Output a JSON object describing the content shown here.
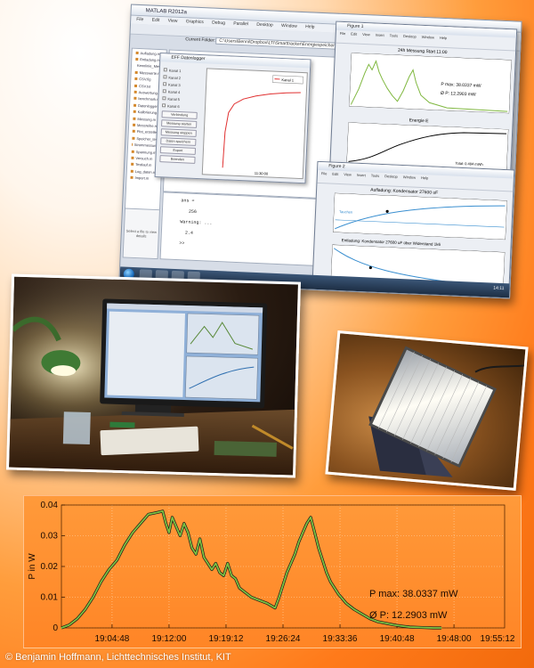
{
  "screenshot": {
    "matlab": {
      "title": "MATLAB R2012a",
      "menu": [
        "File",
        "Edit",
        "View",
        "Graphics",
        "Debug",
        "Parallel",
        "Desktop",
        "Window",
        "Help"
      ],
      "current_folder_label": "Current Folder:",
      "current_folder": "C:\\Users\\Benni\\Dropbox\\LTI\\Smarttracker\\Energiespeicher\\Messungen",
      "folder_items": [
        "Aufladung.m",
        "Entladung.m",
        "Kennlinie_Messung.m",
        "Messwerte.mat",
        "CSV.fig",
        "CSV.txt",
        "Auswertung.m",
        "benchmark.m",
        "Datenlogger.m",
        "Kalibrierung.m",
        "Messung.m",
        "Messreihe.mat",
        "Plot_erstellen.m",
        "Speicher_test.m",
        "Strommessung.m",
        "Spannung.m",
        "Versuch.m",
        "Testlauf.m",
        "Log_daten.m",
        "Import.m"
      ],
      "details_text": "Select a file to view details",
      "command_lines": [
        "ans =",
        "",
        "   256",
        "",
        "Warning: ...",
        "",
        "  2.4",
        "",
        ">> "
      ]
    },
    "dialog": {
      "title": "EFF Datenlogger",
      "checkboxes": [
        "Kanal 1",
        "Kanal 2",
        "Kanal 3",
        "Kanal 4",
        "Kanal 5",
        "Kanal 6"
      ],
      "buttons": [
        "Verbindung",
        "Messung starten",
        "Messung stoppen",
        "Daten speichern",
        "Export",
        "Beenden"
      ],
      "legend": "Kanal 1",
      "x_tick": "11:30:00"
    },
    "figure1": {
      "title": "Figure 1",
      "menu": [
        "File",
        "Edit",
        "View",
        "Insert",
        "Tools",
        "Desktop",
        "Window",
        "Help"
      ],
      "plot1_title": "24h Messung Start 11:00",
      "p_max": "P max: 38.0337 mW",
      "p_avg": "Ø P: 12.2903 mW",
      "plot2_title": "Energie E",
      "energy_total": "Total: 0.494 mWh"
    },
    "figure2": {
      "title": "Figure 2",
      "menu": [
        "File",
        "Edit",
        "View",
        "Insert",
        "Tools",
        "Desktop",
        "Window",
        "Help"
      ],
      "plot1_title": "Aufladung: Kondensator 27600 uF",
      "plot1_legend": "Tauchen",
      "plot2_title": "Entladung: Kondensator 27600 uF über Widerstand 1k6"
    },
    "taskbar_clock": "14:11"
  },
  "chart_data": {
    "type": "line",
    "ylabel": "P in W",
    "ylim": [
      0,
      0.04
    ],
    "yticks": [
      0,
      0.01,
      0.02,
      0.03,
      0.04
    ],
    "ytick_labels": [
      "0",
      "0.01",
      "0.02",
      "0.03",
      "0.04"
    ],
    "xlim_minutes": [
      0,
      56
    ],
    "xtick_labels": [
      "19:04:48",
      "19:12:00",
      "19:19:12",
      "19:26:24",
      "19:33:36",
      "19:40:48",
      "19:48:00",
      "19:55:12"
    ],
    "xticks_minutes": [
      6.4,
      13.6,
      20.8,
      28.0,
      35.2,
      42.4,
      49.6,
      56.8
    ],
    "series": [
      {
        "x_minutes": [
          0,
          1,
          2,
          3,
          4,
          5,
          6,
          7,
          8,
          9,
          10,
          11,
          12,
          12.8,
          13.2,
          13.6,
          14,
          14.5,
          15,
          15.5,
          16,
          16.5,
          17,
          17.5,
          18,
          18.5,
          19,
          19.5,
          20,
          20.5,
          21,
          21.5,
          22,
          22.5,
          23,
          24,
          25,
          26,
          27,
          27.5,
          28,
          28.5,
          29,
          29.5,
          30,
          30.5,
          31,
          31.5,
          32,
          32.5,
          33,
          33.5,
          34,
          35,
          36,
          37,
          38,
          39,
          40,
          41,
          42,
          43,
          44,
          45,
          46,
          47,
          48
        ],
        "y": [
          0,
          0.001,
          0.003,
          0.006,
          0.01,
          0.015,
          0.019,
          0.022,
          0.027,
          0.031,
          0.034,
          0.037,
          0.0375,
          0.038,
          0.034,
          0.031,
          0.036,
          0.033,
          0.03,
          0.034,
          0.031,
          0.026,
          0.024,
          0.029,
          0.023,
          0.021,
          0.019,
          0.021,
          0.018,
          0.017,
          0.021,
          0.017,
          0.016,
          0.013,
          0.012,
          0.01,
          0.009,
          0.008,
          0.0065,
          0.01,
          0.014,
          0.018,
          0.021,
          0.024,
          0.028,
          0.031,
          0.034,
          0.036,
          0.031,
          0.026,
          0.022,
          0.018,
          0.015,
          0.011,
          0.008,
          0.006,
          0.0045,
          0.003,
          0.002,
          0.0015,
          0.001,
          0.0006,
          0.0003,
          0.0002,
          0.0001,
          0,
          0
        ]
      }
    ],
    "annotations": [
      "P max: 38.0337 mW",
      "Ø P: 12.2903 mW"
    ],
    "grid": true,
    "line_color": "#7dc243",
    "line_edge_color": "#1a1a1a"
  },
  "copyright": "© Benjamin Hoffmann, Lichttechnisches Institut, KIT"
}
